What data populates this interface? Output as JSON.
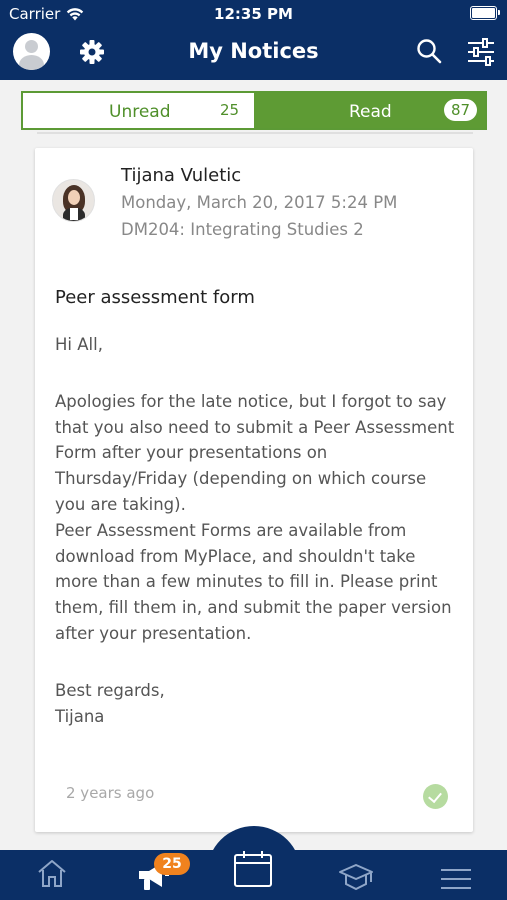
{
  "status_bar": {
    "carrier": "Carrier",
    "time": "12:35 PM"
  },
  "nav": {
    "title": "My Notices",
    "icons": [
      "avatar",
      "gear-icon",
      "search-icon",
      "filter-sliders-icon"
    ]
  },
  "segment": {
    "unread_label": "Unread",
    "unread_count": "25",
    "read_label": "Read",
    "read_count": "87",
    "selected": "Read"
  },
  "notice": {
    "sender_name": "Tijana Vuletic",
    "date": "Monday, March 20, 2017 5:24 PM",
    "course": "DM204: Integrating Studies 2",
    "subject": "Peer assessment form",
    "body": {
      "greeting": "Hi All,",
      "paragraph1": "Apologies for the late notice, but I forgot to say that you also need to submit a Peer Assessment Form after your presentations on Thursday/Friday (depending on which course you are taking).",
      "paragraph2": "Peer Assessment Forms are available from download from MyPlace, and shouldn't take more than a few minutes to fill in. Please print them, fill them in, and submit the paper version after your presentation.",
      "signoff": "Best regards,",
      "signature": "Tijana"
    },
    "relative_time": "2 years ago",
    "read_status": "read"
  },
  "tabbar": {
    "tabs": [
      "home-icon",
      "megaphone-icon",
      "calendar-icon",
      "graduation-cap-icon",
      "menu-icon"
    ],
    "notices_badge": "25",
    "selected": "calendar"
  },
  "colors": {
    "navy": "#0b2f66",
    "green": "#5e9b34",
    "badge_orange": "#f0821e",
    "check_green": "#b6dba0"
  }
}
